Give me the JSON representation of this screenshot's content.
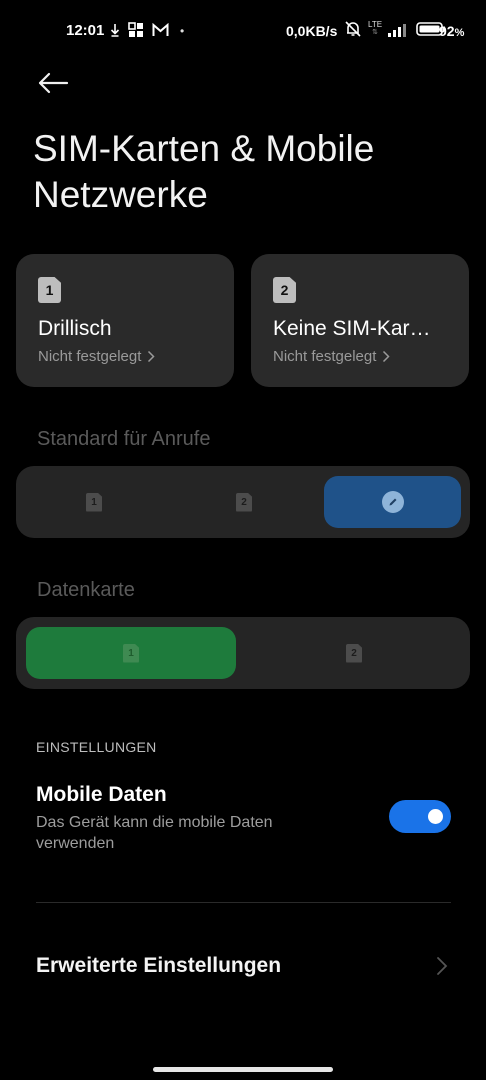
{
  "status_bar": {
    "time": "12:01",
    "speed": "0,0KB/s",
    "network_label": "LTE",
    "battery_percent": "92",
    "battery_unit": "%"
  },
  "header": {
    "title": "SIM-Karten & Mobile Netzwerke"
  },
  "sims": [
    {
      "slot": "1",
      "name": "Drillisch",
      "status": "Nicht festgelegt"
    },
    {
      "slot": "2",
      "name": "Keine SIM-Kar…",
      "status": "Nicht festgelegt"
    }
  ],
  "calls_default": {
    "label": "Standard für Anrufe",
    "options": [
      "1",
      "2"
    ],
    "selected": "edit"
  },
  "data_card": {
    "label": "Datenkarte",
    "options": [
      "1",
      "2"
    ],
    "selected": "1"
  },
  "settings": {
    "header": "EINSTELLUNGEN",
    "mobile_data": {
      "title": "Mobile Daten",
      "description": "Das Gerät kann die mobile Daten verwenden",
      "enabled": true
    },
    "advanced": {
      "label": "Erweiterte Einstellungen"
    }
  },
  "colors": {
    "accent_blue": "#1a73e8",
    "selected_calls": "#1f5289",
    "selected_data": "#1e7b3c"
  }
}
